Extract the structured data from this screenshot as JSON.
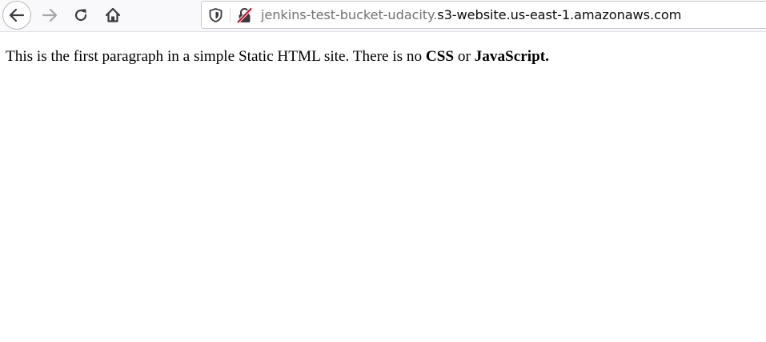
{
  "browser": {
    "address_bar": {
      "subdomain": "jenkins-test-bucket-udacity.",
      "domain": "s3-website.us-east-1.amazonaws.com"
    },
    "icons": {
      "back": "arrow-left-icon",
      "forward": "arrow-right-icon",
      "reload": "reload-icon",
      "home": "home-icon",
      "tracking": "shield-icon",
      "connection": "insecure-lock-icon"
    },
    "colors": {
      "insecure_accent": "#d70022",
      "url_dim": "#737373"
    }
  },
  "page": {
    "paragraph": {
      "text_before": "This is the first paragraph in a simple Static HTML site. There is no ",
      "bold_1": "CSS",
      "text_middle": " or ",
      "bold_2": "JavaScript."
    }
  }
}
